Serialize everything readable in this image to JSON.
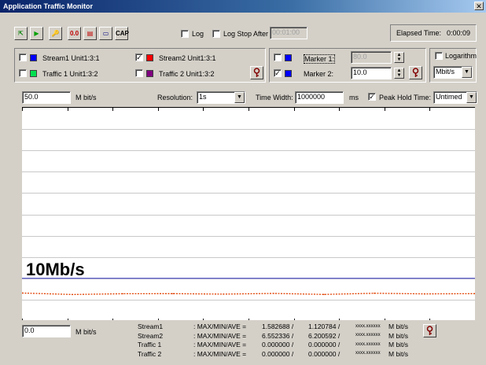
{
  "window": {
    "title": "Application Traffic Monitor",
    "close_glyph": "✕"
  },
  "toolbar": {
    "buttons": [
      {
        "name": "start-icon",
        "glyph": "⇱",
        "color": "#008000"
      },
      {
        "name": "play-icon",
        "glyph": "▶",
        "color": "#00a000"
      },
      {
        "name": "key-icon",
        "glyph": "🔑",
        "color": "#800000"
      },
      {
        "name": "zero-icon",
        "glyph": "0.0",
        "color": "#c00000"
      },
      {
        "name": "chart-icon",
        "glyph": "▤",
        "color": "#c00000"
      },
      {
        "name": "monitor-icon",
        "glyph": "▭",
        "color": "#000080"
      },
      {
        "name": "capture-icon",
        "glyph": "CAP",
        "color": "#000"
      }
    ],
    "log_label": "Log",
    "log_stop_label": "Log Stop After",
    "log_stop_value": "00:01:00",
    "elapsed_label": "Elapsed Time:",
    "elapsed_value": "0:00:09"
  },
  "streams": [
    {
      "label": "Stream1 Unit1:3:1",
      "checked": false,
      "color": "#0000ff"
    },
    {
      "label": "Traffic 1 Unit1:3:2",
      "checked": false,
      "color": "#00e050"
    },
    {
      "label": "Stream2 Unit1:3:1",
      "checked": true,
      "color": "#ff0000"
    },
    {
      "label": "Traffic 2 Unit1:3:2",
      "checked": false,
      "color": "#800080"
    }
  ],
  "markers": [
    {
      "label": "Marker 1:",
      "checked": false,
      "color": "#0000ff",
      "value": "80.0",
      "enabled": false
    },
    {
      "label": "Marker 2:",
      "checked": true,
      "color": "#0000ff",
      "value": "10.0",
      "enabled": true
    }
  ],
  "logarithm": {
    "label": "Logarithm",
    "checked": false,
    "unit": "Mbit/s"
  },
  "scale": {
    "top_value": "50.0",
    "top_unit": "M bit/s",
    "resolution_label": "Resolution:",
    "resolution_value": "1s",
    "time_width_label": "Time Width:",
    "time_width_value": "1000000",
    "time_width_unit": "ms",
    "peak_hold_label": "Peak Hold Time:",
    "peak_hold_checked": true,
    "peak_hold_value": "Untimed",
    "bottom_value": "0.0",
    "bottom_unit": "M bit/s"
  },
  "graph": {
    "marker_label": "10Mb/s",
    "marker_color": "#4040c0",
    "trace_color": "#e04000",
    "chart_data": {
      "type": "line",
      "ylim": [
        0,
        50
      ],
      "y_unit": "M bit/s",
      "marker_line": 10,
      "series": [
        {
          "name": "Stream2",
          "values": [
            6.55,
            6.2,
            6.38,
            6.41,
            6.3,
            6.45,
            6.22,
            6.5,
            6.35,
            6.4
          ]
        }
      ]
    }
  },
  "stats": [
    {
      "name": "Stream1",
      "label": ": MAX/MIN/AVE =",
      "max": "1.582688 /",
      "min": "1.120784 /",
      "ave": "xxxx.xxxxxx",
      "unit": "M bit/s"
    },
    {
      "name": "Stream2",
      "label": ": MAX/MIN/AVE =",
      "max": "6.552336 /",
      "min": "6.200592 /",
      "ave": "xxxx.xxxxxx",
      "unit": "M bit/s"
    },
    {
      "name": "Traffic 1",
      "label": ": MAX/MIN/AVE =",
      "max": "0.000000 /",
      "min": "0.000000 /",
      "ave": "xxxx.xxxxxx",
      "unit": "M bit/s"
    },
    {
      "name": "Traffic 2",
      "label": ": MAX/MIN/AVE =",
      "max": "0.000000 /",
      "min": "0.000000 /",
      "ave": "xxxx.xxxxxx",
      "unit": "M bit/s"
    }
  ]
}
